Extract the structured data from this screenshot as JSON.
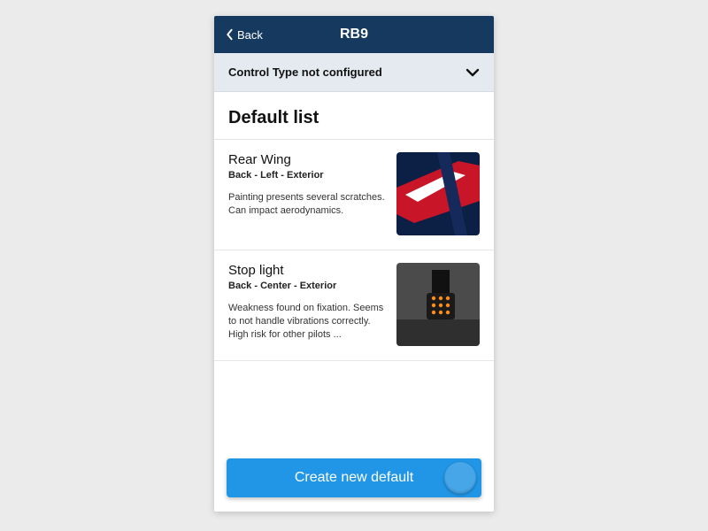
{
  "nav": {
    "back_label": "Back",
    "title": "RB9"
  },
  "selector": {
    "label": "Control Type not configured"
  },
  "section": {
    "title": "Default list"
  },
  "items": [
    {
      "title": "Rear Wing",
      "location": "Back - Left - Exterior",
      "description": "Painting presents several scratches. Can impact aerodynamics.",
      "thumb": "rear-wing"
    },
    {
      "title": "Stop light",
      "location": "Back - Center - Exterior",
      "description": "Weakness found on fixation. Seems to not handle vibrations correctly. High risk for other pilots ...",
      "thumb": "stop-light"
    }
  ],
  "cta": {
    "label": "Create new default"
  },
  "colors": {
    "navbar": "#163a5f",
    "accent": "#2196e6"
  }
}
